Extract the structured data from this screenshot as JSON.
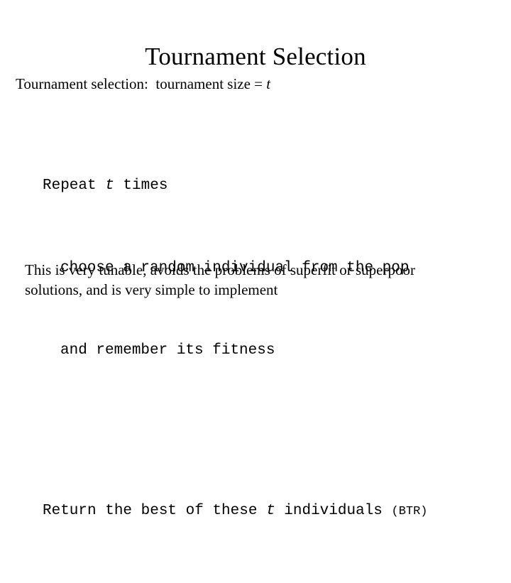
{
  "slide": {
    "title": "Tournament Selection",
    "definition": {
      "prefix": "Tournament selection:  tournament size = ",
      "variable": "t"
    },
    "pseudocode": {
      "lines": [
        {
          "indent": 0,
          "segments": [
            {
              "text": "Repeat ",
              "style": "normal"
            },
            {
              "text": "t",
              "style": "italic"
            },
            {
              "text": " times",
              "style": "normal"
            }
          ]
        },
        {
          "indent": 1,
          "segments": [
            {
              "text": "choose a random individual from the pop",
              "style": "normal"
            }
          ]
        },
        {
          "indent": 1,
          "segments": [
            {
              "text": "and remember its fitness",
              "style": "normal"
            }
          ]
        },
        {
          "indent": 0,
          "blank": true,
          "segments": []
        },
        {
          "indent": 0,
          "segments": [
            {
              "text": "Return the best of these ",
              "style": "normal"
            },
            {
              "text": "t",
              "style": "italic"
            },
            {
              "text": " individuals ",
              "style": "normal"
            },
            {
              "text": "(BTR)",
              "style": "small"
            }
          ]
        }
      ],
      "line_1_part_a": "Repeat ",
      "line_1_var": "t",
      "line_1_part_b": " times",
      "line_2": "choose a random individual from the pop",
      "line_3": "and remember its fitness",
      "line_5_part_a": "Return the best of these ",
      "line_5_var": "t",
      "line_5_part_b": " individuals ",
      "line_5_note": "(BTR)"
    },
    "closing": {
      "line_1": "This is very tunable, avoids the problems of superfit or superpoor",
      "line_2": "solutions, and is very simple to implement"
    }
  },
  "colors": {
    "background": "#ffffff",
    "text": "#000000"
  }
}
